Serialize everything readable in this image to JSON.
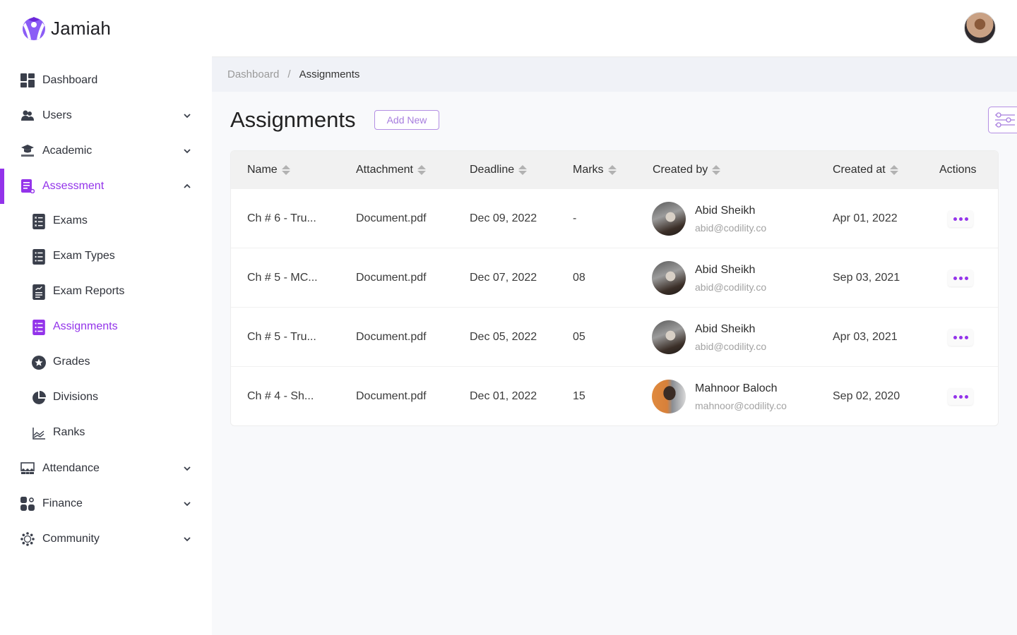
{
  "app": {
    "name": "Jamiah",
    "brand_color": "#9333ea"
  },
  "sidebar": {
    "items": [
      {
        "label": "Dashboard",
        "icon": "dashboard-icon",
        "expandable": false
      },
      {
        "label": "Users",
        "icon": "users-icon",
        "expandable": true,
        "expanded": false
      },
      {
        "label": "Academic",
        "icon": "graduation-cap-icon",
        "expandable": true,
        "expanded": false
      },
      {
        "label": "Assessment",
        "icon": "assessment-icon",
        "expandable": true,
        "expanded": true,
        "active": true
      },
      {
        "label": "Attendance",
        "icon": "attendance-icon",
        "expandable": true,
        "expanded": false
      },
      {
        "label": "Finance",
        "icon": "finance-icon",
        "expandable": true,
        "expanded": false
      },
      {
        "label": "Community",
        "icon": "community-icon",
        "expandable": true,
        "expanded": false
      }
    ],
    "sub_items": [
      {
        "label": "Exams",
        "icon": "checklist-icon"
      },
      {
        "label": "Exam Types",
        "icon": "list-icon"
      },
      {
        "label": "Exam Reports",
        "icon": "report-icon"
      },
      {
        "label": "Assignments",
        "icon": "list-icon",
        "active": true
      },
      {
        "label": "Grades",
        "icon": "star-circle-icon"
      },
      {
        "label": "Divisions",
        "icon": "pie-chart-icon"
      },
      {
        "label": "Ranks",
        "icon": "line-chart-icon"
      }
    ]
  },
  "breadcrumb": {
    "parent": "Dashboard",
    "separator": "/",
    "current": "Assignments"
  },
  "page": {
    "title": "Assignments",
    "add_new_label": "Add New"
  },
  "table": {
    "columns": [
      "Name",
      "Attachment",
      "Deadline",
      "Marks",
      "Created by",
      "Created at",
      "Actions"
    ],
    "rows": [
      {
        "name": "Ch # 6 - Tru...",
        "attachment": "Document.pdf",
        "deadline": "Dec 09, 2022",
        "marks": "-",
        "creator_name": "Abid Sheikh",
        "creator_email": "abid@codility.co",
        "created_at": "Apr 01, 2022"
      },
      {
        "name": "Ch # 5 - MC...",
        "attachment": "Document.pdf",
        "deadline": "Dec 07, 2022",
        "marks": "08",
        "creator_name": "Abid Sheikh",
        "creator_email": "abid@codility.co",
        "created_at": "Sep 03, 2021"
      },
      {
        "name": "Ch # 5 - Tru...",
        "attachment": "Document.pdf",
        "deadline": "Dec 05, 2022",
        "marks": "05",
        "creator_name": "Abid Sheikh",
        "creator_email": "abid@codility.co",
        "created_at": "Apr 03, 2021"
      },
      {
        "name": "Ch # 4 - Sh...",
        "attachment": "Document.pdf",
        "deadline": "Dec 01, 2022",
        "marks": "15",
        "creator_name": "Mahnoor Baloch",
        "creator_email": "mahnoor@codility.co",
        "created_at": "Sep 02, 2020"
      }
    ]
  }
}
